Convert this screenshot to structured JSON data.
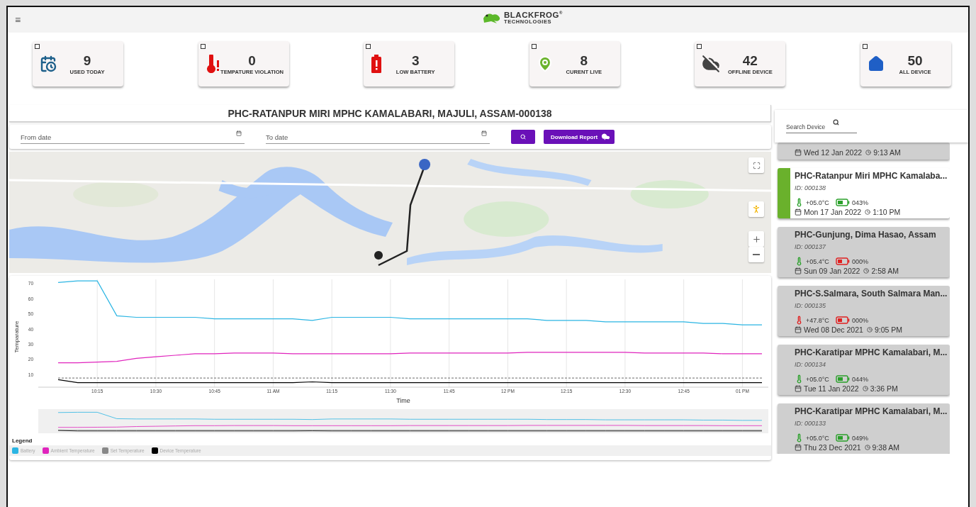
{
  "header": {
    "menu_icon": "≡",
    "logo": {
      "name": "BLACKFROG$^{®}$",
      "tagline": "TECHNOLOGIES"
    }
  },
  "stats": [
    {
      "kind": "used",
      "value": "9",
      "label": "USED TODAY",
      "checked": false
    },
    {
      "kind": "violation",
      "value": "0",
      "label": "TEMPATURE VIOLATION",
      "checked": false
    },
    {
      "kind": "battery",
      "value": "3",
      "label": "LOW BATTERY",
      "checked": false
    },
    {
      "kind": "live",
      "value": "8",
      "label": "CURENT LIVE",
      "checked": false
    },
    {
      "kind": "offline",
      "value": "42",
      "label": "OFFLINE DEVICE",
      "checked": false
    },
    {
      "kind": "all",
      "value": "50",
      "label": "ALL DEVICE",
      "checked": false
    }
  ],
  "device_title": "PHC-RATANPUR MIRI MPHC KAMALABARI, MAJULI, ASSAM-000138",
  "filters": {
    "from_date": {
      "placeholder": "From date"
    },
    "to_date": {
      "placeholder": "To date"
    },
    "download_button": "Download Report"
  },
  "chart_data": {
    "type": "line",
    "grid": true,
    "xlabel": "Time",
    "ylabel": "Temparature",
    "ylim": [
      2,
      73
    ],
    "categories": [
      null,
      null,
      "10:15",
      null,
      null,
      "10:30",
      null,
      null,
      "10:45",
      null,
      null,
      "11 AM",
      null,
      null,
      "11:15",
      null,
      null,
      "11:30",
      null,
      null,
      "11:45",
      null,
      null,
      "12 PM",
      null,
      null,
      "12:15",
      null,
      null,
      "12:30",
      null,
      null,
      "12:45",
      null,
      null,
      "01 PM",
      null
    ],
    "yticks": [
      10,
      20,
      30,
      40,
      50,
      60,
      70
    ],
    "series": [
      {
        "name": "Battery",
        "color": "#2bb5e3",
        "values": [
          71,
          72,
          72,
          49,
          48,
          48,
          48,
          48,
          47,
          47,
          47,
          47,
          47,
          46,
          48,
          48,
          48,
          48,
          47,
          47,
          47,
          47,
          47,
          47,
          47,
          46,
          46,
          46,
          45,
          45,
          45,
          45,
          45,
          44,
          44,
          43,
          43
        ]
      },
      {
        "name": "Ambient Temperature",
        "color": "#e024bd",
        "values": [
          18,
          18,
          18.5,
          19,
          21,
          22,
          23,
          24,
          24,
          24.5,
          24.5,
          24.5,
          24,
          24,
          24,
          24,
          24,
          24,
          24.5,
          24.5,
          24.5,
          24.5,
          24.5,
          24.5,
          25,
          25,
          25,
          25,
          25,
          25,
          24.5,
          24.5,
          24.5,
          24.5,
          24,
          24,
          24
        ]
      },
      {
        "name": "Set Temperature",
        "color": "#888888",
        "line_style": "dashed",
        "values": [
          8,
          8,
          8,
          8,
          8,
          8,
          8,
          8,
          8,
          8,
          8,
          8,
          8,
          8,
          8,
          8,
          8,
          8,
          8,
          8,
          8,
          8,
          8,
          8,
          8,
          8,
          8,
          8,
          8,
          8,
          8,
          8,
          8,
          8,
          8,
          8,
          8
        ]
      },
      {
        "name": "Device Temperature",
        "color": "#000000",
        "values": [
          7,
          5,
          5,
          5,
          5,
          5,
          5,
          5,
          5,
          5,
          5,
          5,
          5,
          5.5,
          5,
          5,
          5,
          5,
          5,
          5,
          5,
          5,
          5,
          5,
          5,
          5,
          5,
          5,
          5,
          5,
          5,
          5,
          5,
          5,
          5,
          5,
          5
        ]
      }
    ]
  },
  "legend_title": "Legend",
  "sidebar": {
    "search": {
      "placeholder": "Search Device"
    },
    "devices": [
      {
        "kind": "partial",
        "selected": false,
        "date": "Wed 12 Jan 2022",
        "time": "9:13 AM"
      },
      {
        "kind": "full",
        "selected": true,
        "name": "PHC-Ratanpur Miri MPHC Kamalaba...",
        "id": "ID: 000138",
        "temperature": "+05.0°C",
        "temp_alert": false,
        "battery": "043%",
        "battery_low": false,
        "date": "Mon 17 Jan 2022",
        "time": "1:10 PM"
      },
      {
        "kind": "full",
        "selected": false,
        "name": "PHC-Gunjung, Dima Hasao, Assam",
        "id": "ID: 000137",
        "temperature": "+05.4°C",
        "temp_alert": false,
        "battery": "000%",
        "battery_low": true,
        "date": "Sun 09 Jan 2022",
        "time": "2:58 AM"
      },
      {
        "kind": "full",
        "selected": false,
        "name": "PHC-S.Salmara, South Salmara Man...",
        "id": "ID: 000135",
        "temperature": "+47.8°C",
        "temp_alert": true,
        "battery": "000%",
        "battery_low": true,
        "date": "Wed 08 Dec 2021",
        "time": "9:05 PM"
      },
      {
        "kind": "full",
        "selected": false,
        "name": "PHC-Karatipar MPHC Kamalabari, M...",
        "id": "ID: 000134",
        "temperature": "+05.0°C",
        "temp_alert": false,
        "battery": "044%",
        "battery_low": false,
        "date": "Tue 11 Jan 2022",
        "time": "3:36 PM"
      },
      {
        "kind": "full",
        "selected": false,
        "name": "PHC-Karatipar MPHC Kamalabari, M...",
        "id": "ID: 000133",
        "temperature": "+05.0°C",
        "temp_alert": false,
        "battery": "049%",
        "battery_low": false,
        "date": "Thu 23 Dec 2021",
        "time": "9:38 AM"
      }
    ]
  }
}
